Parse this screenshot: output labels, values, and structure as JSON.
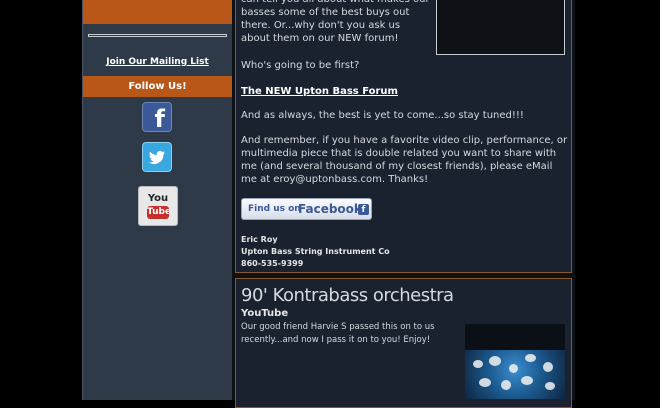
{
  "sidebar": {
    "mailing_label": "Join Our Mailing List",
    "follow_label": "Follow Us!",
    "social": [
      {
        "name": "facebook",
        "glyph": "f"
      },
      {
        "name": "twitter",
        "glyph": ""
      },
      {
        "name": "youtube",
        "you": "You",
        "tube": "Tube"
      }
    ]
  },
  "post": {
    "intro": "can tell you all about what makes our basses some of the best buys out there.  Or...why don't you ask us about them on our NEW forum!",
    "question": "Who's going to be first?",
    "forum_link": "The NEW Upton Bass Forum",
    "stay_tuned": "And as always, the best is yet to come...so stay tuned!!!",
    "remember": "And remember, if you have a favorite video clip, performance, or multimedia piece that is double related you want to share with me (and several thousand of my closest friends), please eMail me at eroy@uptonbass.com.  Thanks!",
    "fb_button": {
      "prefix": "Find us on",
      "brand": "Facebook",
      "badge": "f"
    },
    "signature": [
      "Eric Roy",
      "Upton Bass String Instrument Co",
      "860-535-9399"
    ]
  },
  "video": {
    "title": "90' Kontrabass orchestra",
    "source": "YouTube",
    "description": "Our good friend Harvie S passed this on to us recently...and now I pass it on to you!  Enjoy!"
  },
  "colors": {
    "accent_orange": "#b85718",
    "sidebar_bg": "#2e3a47",
    "panel_bg": "#1a2230",
    "facebook_blue": "#3b5998",
    "twitter_blue": "#39a8e0"
  }
}
